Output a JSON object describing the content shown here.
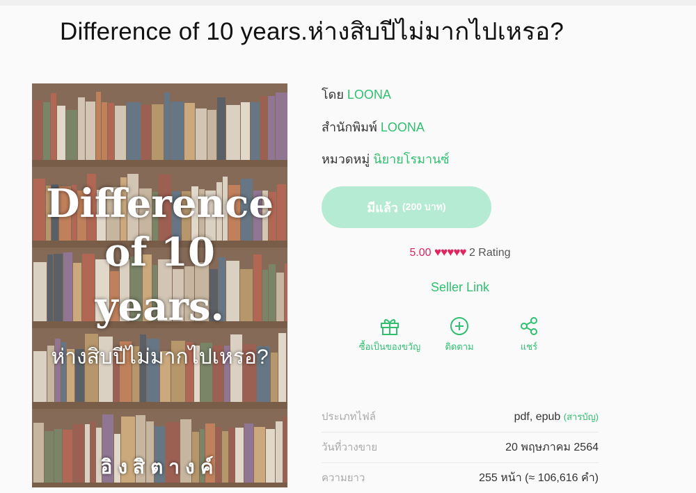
{
  "page": {
    "title": "Difference of 10 years.ห่างสิบปีไม่มากไปเหรอ?"
  },
  "cover": {
    "title_line1": "Difference",
    "title_line2": "of 10",
    "title_line3": "years.",
    "subtitle": "ห่างสิบปีไม่มากไปเหรอ?",
    "author": "อิงสิตางค์"
  },
  "info": {
    "author_label": "โดย",
    "author_value": "LOONA",
    "publisher_label": "สำนักพิมพ์",
    "publisher_value": "LOONA",
    "category_label": "หมวดหมู่",
    "category_value": "นิยายโรมานซ์"
  },
  "buy": {
    "label": "มีแล้ว",
    "price": "(200 บาท)"
  },
  "rating": {
    "score": "5.00",
    "hearts": "♥♥♥♥♥",
    "count": "2 Rating",
    "value": 5.0
  },
  "seller_link": "Seller Link",
  "actions": {
    "gift": "ซื้อเป็นของขวัญ",
    "follow": "ติดตาม",
    "share": "แชร์"
  },
  "details": {
    "file_type_label": "ประเภทไฟล์",
    "file_type_value": "pdf, epub",
    "toc": "(สารบัญ)",
    "release_label": "วันที่วางขาย",
    "release_value": "20 พฤษภาคม 2564",
    "length_label": "ความยาว",
    "length_value": "255 หน้า (≈ 106,616 คำ)"
  },
  "colors": {
    "accent": "#2fbf6f",
    "button": "#b5ebd3",
    "heart": "#e0245e"
  }
}
